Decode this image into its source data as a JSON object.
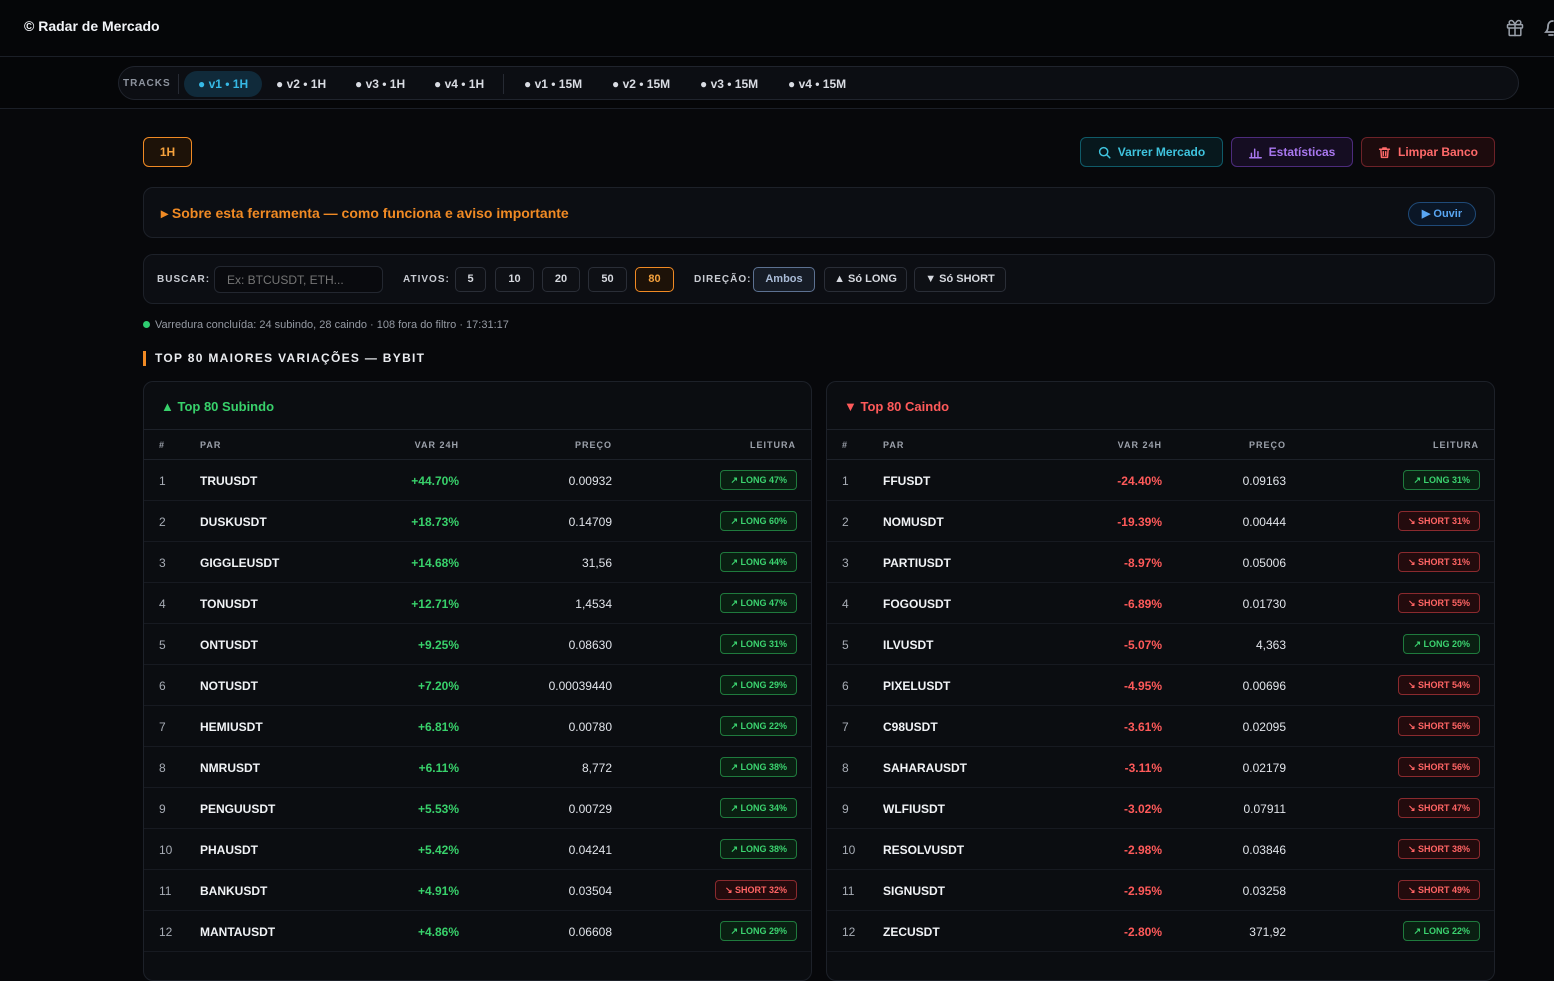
{
  "header": {
    "brand": "© Radar de Mercado",
    "icons": [
      "gift-icon",
      "bell-icon"
    ]
  },
  "tracks": {
    "label": "TRACKS",
    "items": [
      "● v1 • 1H",
      "● v2 • 1H",
      "● v3 • 1H",
      "● v4 • 1H",
      "● v1 • 15M",
      "● v2 • 15M",
      "● v3 • 15M",
      "● v4 • 15M"
    ],
    "active_index": 0
  },
  "toolbar": {
    "timeframe": "1H",
    "scan_label": "Varrer Mercado",
    "stats_label": "Estatísticas",
    "clear_label": "Limpar Banco"
  },
  "about": {
    "title": "▸ Sobre esta ferramenta — como funciona e aviso importante",
    "listen_label": "▶ Ouvir"
  },
  "filters": {
    "search_label": "BUSCAR:",
    "search_placeholder": "Ex: BTCUSDT, ETH...",
    "assets_label": "ATIVOS:",
    "assets_options": [
      "5",
      "10",
      "20",
      "50",
      "80"
    ],
    "assets_selected": "80",
    "direction_label": "DIREÇÃO:",
    "direction_options": [
      "Ambos",
      "▲ Só LONG",
      "▼ Só SHORT"
    ],
    "direction_selected": "Ambos"
  },
  "status": "Varredura concluída: 24 subindo, 28 caindo · 108 fora do filtro · 17:31:17",
  "section_title": "TOP 80 MAIORES VARIAÇÕES — BYBIT",
  "columns": {
    "idx": "#",
    "pair": "PAR",
    "var": "VAR 24H",
    "price": "PREÇO",
    "reading": "LEITURA"
  },
  "gainers": {
    "title": "▲ Top 80 Subindo",
    "rows": [
      {
        "idx": "1",
        "pair": "TRUUSDT",
        "var": "+44.70%",
        "price": "0.00932",
        "reading": "↗ LONG 47%",
        "dir": "long"
      },
      {
        "idx": "2",
        "pair": "DUSKUSDT",
        "var": "+18.73%",
        "price": "0.14709",
        "reading": "↗ LONG 60%",
        "dir": "long"
      },
      {
        "idx": "3",
        "pair": "GIGGLEUSDT",
        "var": "+14.68%",
        "price": "31,56",
        "reading": "↗ LONG 44%",
        "dir": "long"
      },
      {
        "idx": "4",
        "pair": "TONUSDT",
        "var": "+12.71%",
        "price": "1,4534",
        "reading": "↗ LONG 47%",
        "dir": "long"
      },
      {
        "idx": "5",
        "pair": "ONTUSDT",
        "var": "+9.25%",
        "price": "0.08630",
        "reading": "↗ LONG 31%",
        "dir": "long"
      },
      {
        "idx": "6",
        "pair": "NOTUSDT",
        "var": "+7.20%",
        "price": "0.00039440",
        "reading": "↗ LONG 29%",
        "dir": "long"
      },
      {
        "idx": "7",
        "pair": "HEMIUSDT",
        "var": "+6.81%",
        "price": "0.00780",
        "reading": "↗ LONG 22%",
        "dir": "long"
      },
      {
        "idx": "8",
        "pair": "NMRUSDT",
        "var": "+6.11%",
        "price": "8,772",
        "reading": "↗ LONG 38%",
        "dir": "long"
      },
      {
        "idx": "9",
        "pair": "PENGUUSDT",
        "var": "+5.53%",
        "price": "0.00729",
        "reading": "↗ LONG 34%",
        "dir": "long"
      },
      {
        "idx": "10",
        "pair": "PHAUSDT",
        "var": "+5.42%",
        "price": "0.04241",
        "reading": "↗ LONG 38%",
        "dir": "long"
      },
      {
        "idx": "11",
        "pair": "BANKUSDT",
        "var": "+4.91%",
        "price": "0.03504",
        "reading": "↘ SHORT 32%",
        "dir": "short"
      },
      {
        "idx": "12",
        "pair": "MANTAUSDT",
        "var": "+4.86%",
        "price": "0.06608",
        "reading": "↗ LONG 29%",
        "dir": "long"
      }
    ]
  },
  "losers": {
    "title": "▼ Top 80 Caindo",
    "rows": [
      {
        "idx": "1",
        "pair": "FFUSDT",
        "var": "-24.40%",
        "price": "0.09163",
        "reading": "↗ LONG 31%",
        "dir": "long"
      },
      {
        "idx": "2",
        "pair": "NOMUSDT",
        "var": "-19.39%",
        "price": "0.00444",
        "reading": "↘ SHORT 31%",
        "dir": "short"
      },
      {
        "idx": "3",
        "pair": "PARTIUSDT",
        "var": "-8.97%",
        "price": "0.05006",
        "reading": "↘ SHORT 31%",
        "dir": "short"
      },
      {
        "idx": "4",
        "pair": "FOGOUSDT",
        "var": "-6.89%",
        "price": "0.01730",
        "reading": "↘ SHORT 55%",
        "dir": "short"
      },
      {
        "idx": "5",
        "pair": "ILVUSDT",
        "var": "-5.07%",
        "price": "4,363",
        "reading": "↗ LONG 20%",
        "dir": "long"
      },
      {
        "idx": "6",
        "pair": "PIXELUSDT",
        "var": "-4.95%",
        "price": "0.00696",
        "reading": "↘ SHORT 54%",
        "dir": "short"
      },
      {
        "idx": "7",
        "pair": "C98USDT",
        "var": "-3.61%",
        "price": "0.02095",
        "reading": "↘ SHORT 56%",
        "dir": "short"
      },
      {
        "idx": "8",
        "pair": "SAHARAUSDT",
        "var": "-3.11%",
        "price": "0.02179",
        "reading": "↘ SHORT 56%",
        "dir": "short"
      },
      {
        "idx": "9",
        "pair": "WLFIUSDT",
        "var": "-3.02%",
        "price": "0.07911",
        "reading": "↘ SHORT 47%",
        "dir": "short"
      },
      {
        "idx": "10",
        "pair": "RESOLVUSDT",
        "var": "-2.98%",
        "price": "0.03846",
        "reading": "↘ SHORT 38%",
        "dir": "short"
      },
      {
        "idx": "11",
        "pair": "SIGNUSDT",
        "var": "-2.95%",
        "price": "0.03258",
        "reading": "↘ SHORT 49%",
        "dir": "short"
      },
      {
        "idx": "12",
        "pair": "ZECUSDT",
        "var": "-2.80%",
        "price": "371,92",
        "reading": "↗ LONG 22%",
        "dir": "long"
      }
    ]
  }
}
